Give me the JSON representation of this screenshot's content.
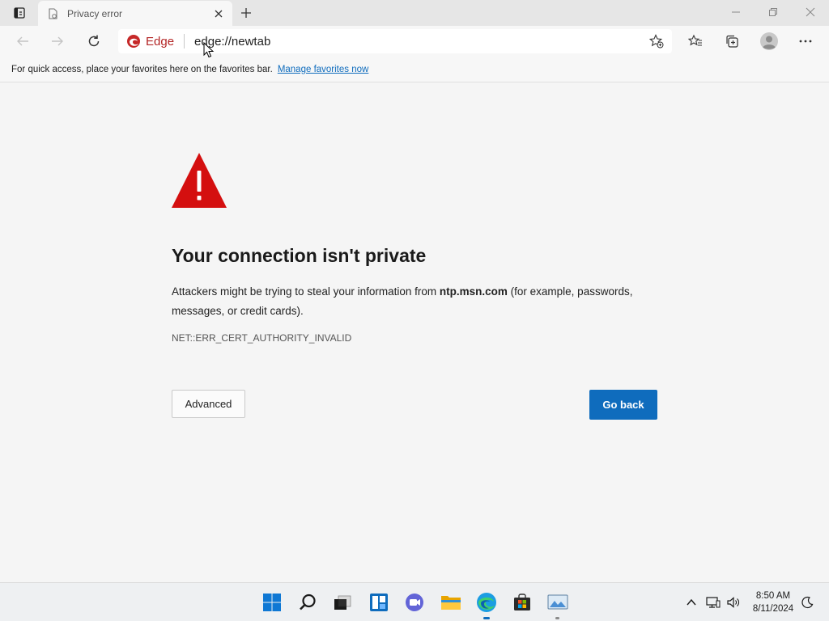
{
  "window": {
    "tab_title": "Privacy error"
  },
  "toolbar": {
    "brand": "Edge",
    "url": "edge://newtab"
  },
  "favorites_bar": {
    "message": "For quick access, place your favorites here on the favorites bar.",
    "link": "Manage favorites now"
  },
  "error": {
    "title": "Your connection isn't private",
    "desc_before": "Attackers might be trying to steal your information from ",
    "host": "ntp.msn.com",
    "desc_after": " (for example, passwords, messages, or credit cards).",
    "code": "NET::ERR_CERT_AUTHORITY_INVALID",
    "advanced_label": "Advanced",
    "goback_label": "Go back"
  },
  "taskbar": {
    "time": "8:50 AM",
    "date": "8/11/2024"
  },
  "colors": {
    "accent": "#0f6cbd",
    "warning": "#d40f0f",
    "brand_red": "#b32424"
  },
  "icons": [
    "tab-actions-icon",
    "page-icon",
    "close-icon",
    "plus-icon",
    "minimize-icon",
    "restore-icon",
    "window-close-icon",
    "back-arrow-icon",
    "forward-arrow-icon",
    "refresh-icon",
    "edge-logo-icon",
    "add-favorite-icon",
    "favorites-icon",
    "collections-icon",
    "profile-icon",
    "more-icon",
    "warning-icon",
    "windows-start-icon",
    "search-icon",
    "task-view-icon",
    "widgets-icon",
    "chat-icon",
    "file-explorer-icon",
    "edge-taskbar-icon",
    "store-icon",
    "photos-icon",
    "chevron-up-icon",
    "network-icon",
    "volume-icon",
    "notification-icon",
    "mouse-cursor-icon"
  ]
}
